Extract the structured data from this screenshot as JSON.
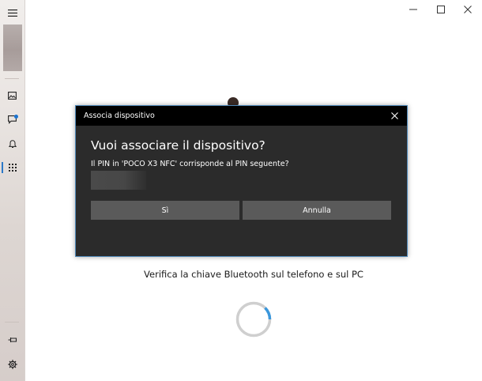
{
  "dialog": {
    "title": "Associa dispositivo",
    "heading": "Vuoi associare il dispositivo?",
    "message": "Il PIN in 'POCO X3 NFC' corrisponde al PIN seguente?",
    "yes_label": "Sì",
    "cancel_label": "Annulla"
  },
  "status": {
    "verify_text": "Verifica la chiave Bluetooth sul telefono e sul PC"
  },
  "colors": {
    "dialog_bg": "#2b2b2b",
    "dialog_titlebar": "#000000",
    "button_bg": "#5a5a5a",
    "accent": "#2b78c8",
    "spinner_accent": "#3a97dc"
  },
  "icons": {
    "rail": [
      "hamburger-icon",
      "photos-icon",
      "messages-icon",
      "notifications-icon",
      "apps-icon",
      "pin-icon",
      "settings-icon"
    ],
    "window": [
      "minimize-icon",
      "maximize-icon",
      "close-icon"
    ]
  }
}
